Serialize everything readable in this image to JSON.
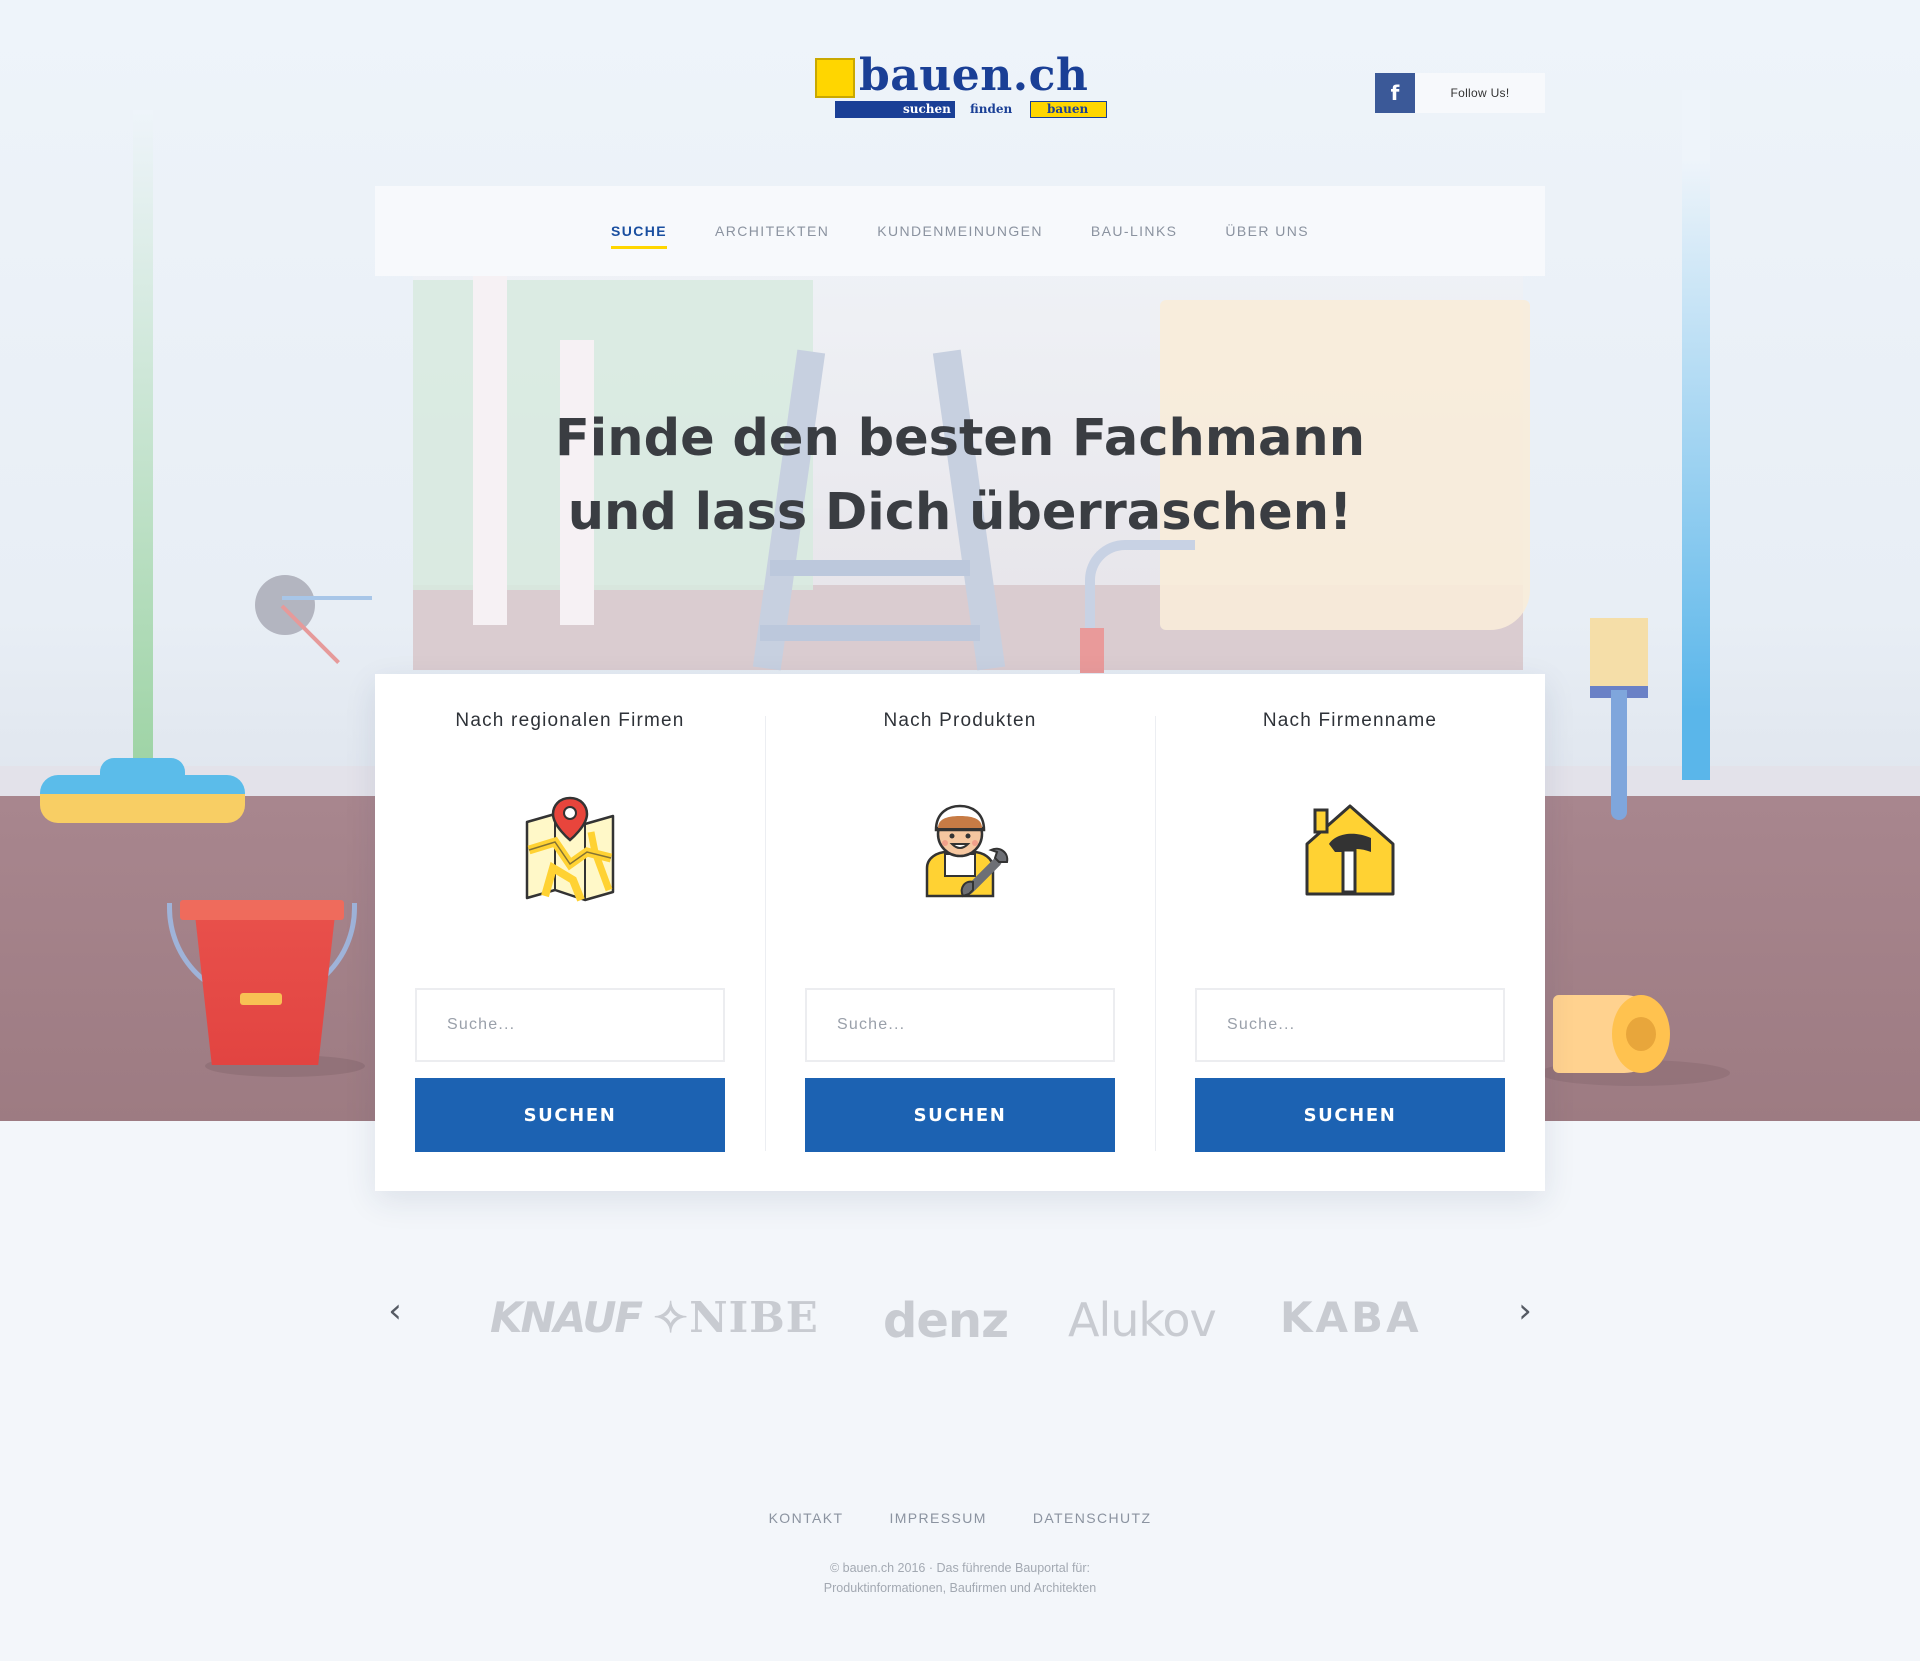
{
  "header": {
    "logo": {
      "wordmark": "bauen.ch",
      "tagline": [
        "suchen",
        "finden",
        "bauen"
      ]
    },
    "social": {
      "icon": "facebook-icon",
      "icon_glyph": "f",
      "label": "Follow Us!",
      "color": "#3b5998"
    }
  },
  "nav": {
    "items": [
      {
        "label": "SUCHE",
        "active": true
      },
      {
        "label": "ARCHITEKTEN",
        "active": false
      },
      {
        "label": "KUNDENMEINUNGEN",
        "active": false
      },
      {
        "label": "BAU-LINKS",
        "active": false
      },
      {
        "label": "ÜBER UNS",
        "active": false
      }
    ],
    "active_color": "#1a4fa0",
    "underline_color": "#ffd600"
  },
  "hero": {
    "title_line1": "Finde den besten Fachmann",
    "title_line2": "und lass Dich überraschen!"
  },
  "search": {
    "columns": [
      {
        "title": "Nach regionalen Firmen",
        "icon": "map-pin-icon",
        "placeholder": "Suche...",
        "button": "SUCHEN"
      },
      {
        "title": "Nach Produkten",
        "icon": "worker-icon",
        "placeholder": "Suche...",
        "button": "SUCHEN"
      },
      {
        "title": "Nach Firmenname",
        "icon": "house-hammer-icon",
        "placeholder": "Suche...",
        "button": "SUCHEN"
      }
    ],
    "button_color": "#1c62b2"
  },
  "brands": {
    "prev_icon": "chevron-left-icon",
    "next_icon": "chevron-right-icon",
    "prev_glyph": "‹",
    "next_glyph": "›",
    "logos": [
      "KNAUF",
      "NIBE",
      "denz",
      "Alukov",
      "KABA"
    ]
  },
  "footer": {
    "links": [
      "KONTAKT",
      "IMPRESSUM",
      "DATENSCHUTZ"
    ],
    "copyright_line1": "© bauen.ch 2016 · Das führende Bauportal für:",
    "copyright_line2": "Produktinformationen, Baufirmen und Architekten"
  }
}
